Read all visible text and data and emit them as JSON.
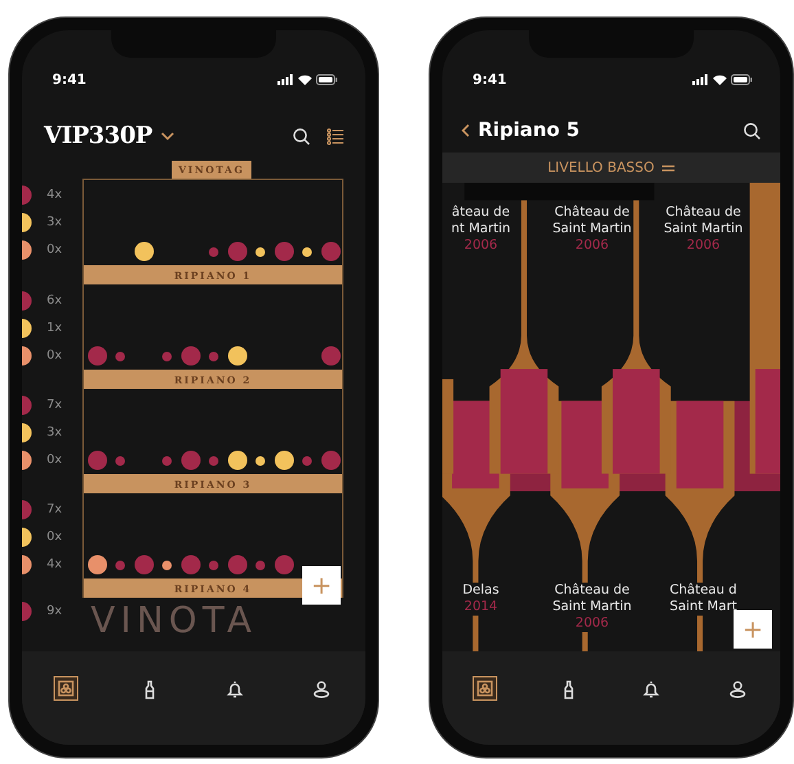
{
  "cellar_screen": {
    "status_time": "9:41",
    "title": "VIP330P",
    "badge": "VINOTAG",
    "shelves": [
      {
        "label": "RIPIANO 1",
        "legend": [
          {
            "color": "#a3294a",
            "count": "4x"
          },
          {
            "color": "#f2c25c",
            "count": "3x"
          },
          {
            "color": "#e8906a",
            "count": "0x"
          }
        ],
        "dots": [
          {
            "kind": "empty"
          },
          {
            "kind": "empty"
          },
          {
            "kind": "large",
            "color": "#f2c25c"
          },
          {
            "kind": "empty"
          },
          {
            "kind": "empty"
          },
          {
            "kind": "small",
            "color": "#a3294a"
          },
          {
            "kind": "large",
            "color": "#a3294a"
          },
          {
            "kind": "small",
            "color": "#f2c25c"
          },
          {
            "kind": "large",
            "color": "#a3294a"
          },
          {
            "kind": "small",
            "color": "#f2c25c"
          },
          {
            "kind": "large",
            "color": "#a3294a"
          }
        ]
      },
      {
        "label": "RIPIANO 2",
        "legend": [
          {
            "color": "#a3294a",
            "count": "6x"
          },
          {
            "color": "#f2c25c",
            "count": "1x"
          },
          {
            "color": "#e8906a",
            "count": "0x"
          }
        ],
        "dots": [
          {
            "kind": "large",
            "color": "#a3294a"
          },
          {
            "kind": "small",
            "color": "#a3294a"
          },
          {
            "kind": "empty"
          },
          {
            "kind": "small",
            "color": "#a3294a"
          },
          {
            "kind": "large",
            "color": "#a3294a"
          },
          {
            "kind": "small",
            "color": "#a3294a"
          },
          {
            "kind": "large",
            "color": "#f2c25c"
          },
          {
            "kind": "empty"
          },
          {
            "kind": "empty"
          },
          {
            "kind": "empty"
          },
          {
            "kind": "large",
            "color": "#a3294a"
          }
        ]
      },
      {
        "label": "RIPIANO 3",
        "legend": [
          {
            "color": "#a3294a",
            "count": "7x"
          },
          {
            "color": "#f2c25c",
            "count": "3x"
          },
          {
            "color": "#e8906a",
            "count": "0x"
          }
        ],
        "dots": [
          {
            "kind": "large",
            "color": "#a3294a"
          },
          {
            "kind": "small",
            "color": "#a3294a"
          },
          {
            "kind": "empty"
          },
          {
            "kind": "small",
            "color": "#a3294a"
          },
          {
            "kind": "large",
            "color": "#a3294a"
          },
          {
            "kind": "small",
            "color": "#a3294a"
          },
          {
            "kind": "large",
            "color": "#f2c25c"
          },
          {
            "kind": "small",
            "color": "#f2c25c"
          },
          {
            "kind": "large",
            "color": "#f2c25c"
          },
          {
            "kind": "small",
            "color": "#a3294a"
          },
          {
            "kind": "large",
            "color": "#a3294a"
          }
        ]
      },
      {
        "label": "RIPIANO 4",
        "legend": [
          {
            "color": "#a3294a",
            "count": "7x"
          },
          {
            "color": "#f2c25c",
            "count": "0x"
          },
          {
            "color": "#e8906a",
            "count": "4x"
          }
        ],
        "dots": [
          {
            "kind": "large",
            "color": "#e8906a"
          },
          {
            "kind": "small",
            "color": "#a3294a"
          },
          {
            "kind": "large",
            "color": "#a3294a"
          },
          {
            "kind": "small",
            "color": "#e8906a"
          },
          {
            "kind": "large",
            "color": "#a3294a"
          },
          {
            "kind": "small",
            "color": "#a3294a"
          },
          {
            "kind": "large",
            "color": "#a3294a"
          },
          {
            "kind": "small",
            "color": "#a3294a"
          },
          {
            "kind": "large",
            "color": "#a3294a"
          }
        ]
      }
    ],
    "partial_legend": [
      {
        "color": "#a3294a",
        "count": "9x"
      }
    ],
    "background_logo": "VINOTA",
    "add_button": "+",
    "nav": [
      {
        "kind": "cellar",
        "selected": true
      },
      {
        "kind": "bottle",
        "selected": false
      },
      {
        "kind": "bell",
        "selected": false
      },
      {
        "kind": "profile",
        "selected": false
      }
    ]
  },
  "shelf_screen": {
    "status_time": "9:41",
    "title": "Ripiano 5",
    "level_label": "LIVELLO BASSO",
    "top_labels": [
      {
        "lines": [
          "âteau de",
          "nt Martin"
        ],
        "year": "2006"
      },
      {
        "lines": [
          "Château de",
          "Saint Martin"
        ],
        "year": "2006"
      },
      {
        "lines": [
          "Château de",
          "Saint Martin"
        ],
        "year": "2006"
      }
    ],
    "bottom_labels": [
      {
        "lines": [
          "Delas"
        ],
        "year": "2014"
      },
      {
        "lines": [
          "Château de",
          "Saint Martin"
        ],
        "year": "2006"
      },
      {
        "lines": [
          "Château d",
          "Saint Mart"
        ]
      }
    ],
    "add_button": "+",
    "nav": [
      {
        "kind": "cellar",
        "selected": true
      },
      {
        "kind": "bottle",
        "selected": false
      },
      {
        "kind": "bell",
        "selected": false
      },
      {
        "kind": "profile",
        "selected": false
      }
    ]
  }
}
